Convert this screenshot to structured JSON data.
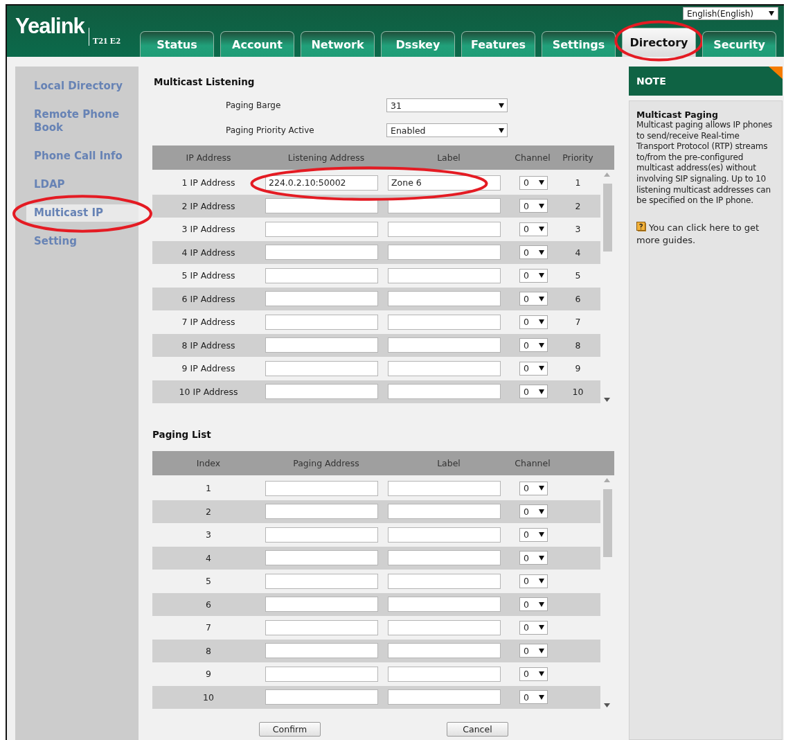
{
  "header": {
    "logo": "Yealink",
    "model": "T21 E2",
    "language": "English(English)"
  },
  "tabs": [
    {
      "label": "Status",
      "selected": false,
      "circled": false
    },
    {
      "label": "Account",
      "selected": false,
      "circled": false
    },
    {
      "label": "Network",
      "selected": false,
      "circled": false
    },
    {
      "label": "Dsskey",
      "selected": false,
      "circled": false
    },
    {
      "label": "Features",
      "selected": false,
      "circled": false
    },
    {
      "label": "Settings",
      "selected": false,
      "circled": false
    },
    {
      "label": "Directory",
      "selected": true,
      "circled": true
    },
    {
      "label": "Security",
      "selected": false,
      "circled": false
    }
  ],
  "sidebar": [
    {
      "label": "Local Directory",
      "selected": false,
      "circled": false
    },
    {
      "label": "Remote Phone Book",
      "selected": false,
      "circled": false
    },
    {
      "label": "Phone Call Info",
      "selected": false,
      "circled": false
    },
    {
      "label": "LDAP",
      "selected": false,
      "circled": false
    },
    {
      "label": "Multicast IP",
      "selected": true,
      "circled": true
    },
    {
      "label": "Setting",
      "selected": false,
      "circled": false
    }
  ],
  "multicast_listening": {
    "title": "Multicast Listening",
    "settings": [
      {
        "label": "Paging Barge",
        "value": "31"
      },
      {
        "label": "Paging Priority Active",
        "value": "Enabled"
      }
    ],
    "columns": [
      "IP Address",
      "Listening Address",
      "Label",
      "Channel",
      "Priority"
    ],
    "rows": [
      {
        "name": "1 IP Address",
        "address": "224.0.2.10:50002",
        "label": "Zone 6",
        "channel": "0",
        "priority": "1",
        "circled": true
      },
      {
        "name": "2 IP Address",
        "channel": "0",
        "priority": "2",
        "circled": false
      },
      {
        "name": "3 IP Address",
        "channel": "0",
        "priority": "3",
        "circled": false
      },
      {
        "name": "4 IP Address",
        "channel": "0",
        "priority": "4",
        "circled": false
      },
      {
        "name": "5 IP Address",
        "channel": "0",
        "priority": "5",
        "circled": false
      },
      {
        "name": "6 IP Address",
        "channel": "0",
        "priority": "6",
        "circled": false
      },
      {
        "name": "7 IP Address",
        "channel": "0",
        "priority": "7",
        "circled": false
      },
      {
        "name": "8 IP Address",
        "channel": "0",
        "priority": "8",
        "circled": false
      },
      {
        "name": "9 IP Address",
        "channel": "0",
        "priority": "9",
        "circled": false
      },
      {
        "name": "10 IP Address",
        "channel": "0",
        "priority": "10",
        "circled": false
      }
    ]
  },
  "paging_list": {
    "title": "Paging List",
    "columns": [
      "Index",
      "Paging Address",
      "Label",
      "Channel"
    ],
    "rows": [
      {
        "index": "1",
        "channel": "0"
      },
      {
        "index": "2",
        "channel": "0"
      },
      {
        "index": "3",
        "channel": "0"
      },
      {
        "index": "4",
        "channel": "0"
      },
      {
        "index": "5",
        "channel": "0"
      },
      {
        "index": "6",
        "channel": "0"
      },
      {
        "index": "7",
        "channel": "0"
      },
      {
        "index": "8",
        "channel": "0"
      },
      {
        "index": "9",
        "channel": "0"
      },
      {
        "index": "10",
        "channel": "0"
      }
    ]
  },
  "buttons": [
    "Confirm",
    "Cancel"
  ],
  "note": {
    "title": "NOTE",
    "heading": "Multicast Paging",
    "body": "Multicast paging allows IP phones to send/receive Real-time Transport Protocol (RTP) streams to/from the pre-configured multicast address(es) without involving SIP signaling. Up to 10 listening multicast addresses can be specified on the IP phone.",
    "link": "You can click here to get more guides."
  }
}
